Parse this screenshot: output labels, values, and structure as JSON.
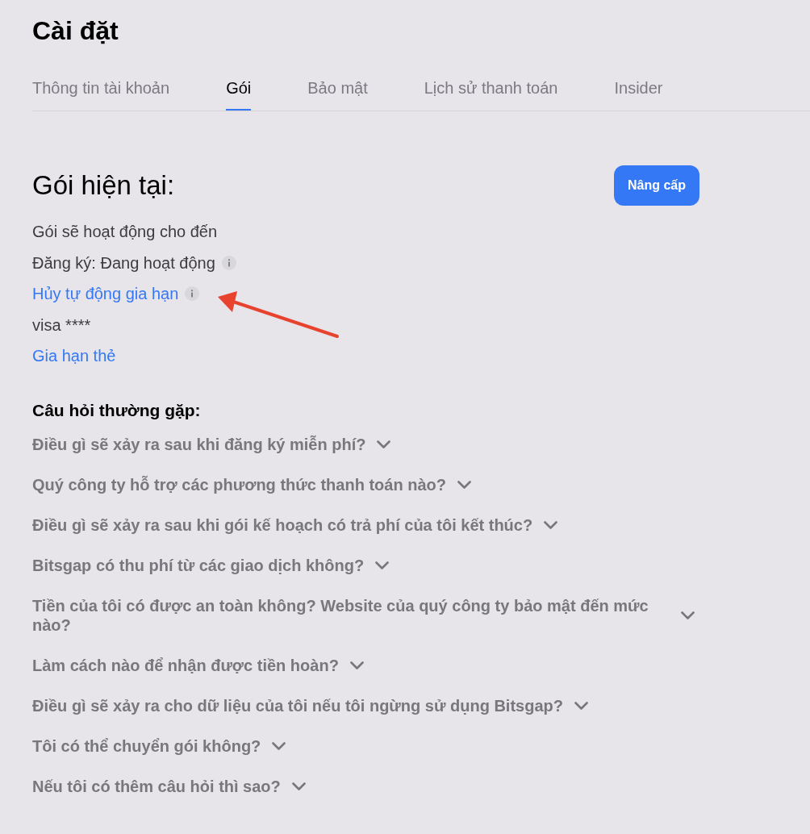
{
  "page": {
    "title": "Cài đặt"
  },
  "tabs": [
    {
      "label": "Thông tin tài khoản",
      "selected": false
    },
    {
      "label": "Gói",
      "selected": true
    },
    {
      "label": "Bảo mật",
      "selected": false
    },
    {
      "label": "Lịch sử thanh toán",
      "selected": false
    },
    {
      "label": "Insider",
      "selected": false
    }
  ],
  "plan": {
    "heading": "Gói hiện tại:",
    "upgrade_button": "Nâng cấp",
    "lines": [
      {
        "kind": "text",
        "text": "Gói sẽ hoạt động cho đến",
        "info": false
      },
      {
        "kind": "text",
        "text": "Đăng ký: Đang hoạt động",
        "info": true
      },
      {
        "kind": "link",
        "text": "Hủy tự động gia hạn",
        "info": true
      },
      {
        "kind": "text",
        "text": "visa ****",
        "info": false
      },
      {
        "kind": "link",
        "text": "Gia hạn thẻ",
        "info": false
      }
    ]
  },
  "faq": {
    "heading": "Câu hỏi thường gặp:",
    "items": [
      {
        "question": "Điều gì sẽ xảy ra sau khi đăng ký miễn phí?",
        "expanded": false
      },
      {
        "question": "Quý công ty hỗ trợ các phương thức thanh toán nào?",
        "expanded": false
      },
      {
        "question": "Điều gì sẽ xảy ra sau khi gói kế hoạch có trả phí của tôi kết thúc?",
        "expanded": false
      },
      {
        "question": "Bitsgap có thu phí từ các giao dịch không?",
        "expanded": false
      },
      {
        "question": "Tiền của tôi có được an toàn không? Website của quý công ty bảo mật đến mức nào?",
        "expanded": false
      },
      {
        "question": "Làm cách nào để nhận được tiền hoàn?",
        "expanded": false
      },
      {
        "question": "Điều gì sẽ xảy ra cho dữ liệu của tôi nếu tôi ngừng sử dụng Bitsgap?",
        "expanded": false
      },
      {
        "question": "Tôi có thể chuyển gói không?",
        "expanded": false
      },
      {
        "question": "Nếu tôi có thêm câu hỏi thì sao?",
        "expanded": false
      }
    ]
  }
}
